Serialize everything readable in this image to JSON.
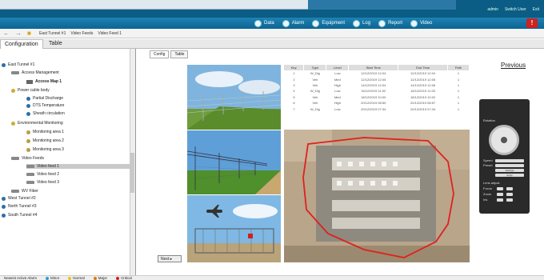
{
  "header": {
    "user": "admin",
    "switch_user": "Switch User",
    "exit": "Exit",
    "alarm_badge": "!"
  },
  "menu": [
    {
      "label": "Data",
      "icon": "data-icon"
    },
    {
      "label": "Alarm",
      "icon": "alarm-icon"
    },
    {
      "label": "Equipment",
      "icon": "equipment-icon"
    },
    {
      "label": "Log",
      "icon": "log-icon"
    },
    {
      "label": "Report",
      "icon": "report-icon"
    },
    {
      "label": "Video",
      "icon": "video-icon"
    }
  ],
  "breadcrumb": [
    "East Tunnel #1",
    "Video Feeds",
    "Video Feed 1"
  ],
  "main_tabs": [
    "Configuration",
    "Table"
  ],
  "sub_tabs": [
    "Config",
    "Table"
  ],
  "tree": [
    {
      "label": "East Tunnel #1",
      "level": 0
    },
    {
      "label": "Access Management",
      "level": 1
    },
    {
      "label": "Access Map 1",
      "level": 2,
      "bold": true
    },
    {
      "label": "Power cable body",
      "level": 1
    },
    {
      "label": "Partial Discharge",
      "level": 2
    },
    {
      "label": "DTS Temperature",
      "level": 2
    },
    {
      "label": "Sheath circulation",
      "level": 2
    },
    {
      "label": "Environmental Monitoring",
      "level": 1
    },
    {
      "label": "Monitoring area 1",
      "level": 2
    },
    {
      "label": "Monitoring area 2",
      "level": 2
    },
    {
      "label": "Monitoring area 3",
      "level": 2
    },
    {
      "label": "Video Feeds",
      "level": 1
    },
    {
      "label": "Video feed 1",
      "level": 2,
      "selected": true
    },
    {
      "label": "Video feed 2",
      "level": 2
    },
    {
      "label": "Video feed 3",
      "level": 2
    },
    {
      "label": "WV Fiber",
      "level": 1
    },
    {
      "label": "West Tunnel #2",
      "level": 0
    },
    {
      "label": "North Tunnel #3",
      "level": 0
    },
    {
      "label": "South Tunnel #4",
      "level": 0
    }
  ],
  "alarm_table": {
    "columns": [
      "Key",
      "Type",
      "Level",
      "Start Time",
      "End Time",
      "Path"
    ],
    "rows": [
      [
        "1",
        "W_Dig",
        "Low",
        "12/12/2019 12:04",
        "12/12/2019 12:04",
        "1"
      ],
      [
        "2",
        "Veh",
        "Med",
        "12/12/2019 12:05",
        "12/12/2019 12:05",
        "1"
      ],
      [
        "3",
        "Veh",
        "High",
        "14/12/2019 12:04",
        "14/12/2019 12:06",
        "1"
      ],
      [
        "4",
        "W_Dig",
        "Low",
        "16/12/2019 11:02",
        "16/12/2019 11:03",
        "1"
      ],
      [
        "5",
        "Veh",
        "Med",
        "18/12/2019 10:00",
        "18/12/2019 10:02",
        "1"
      ],
      [
        "6",
        "Veh",
        "High",
        "20/12/2019 08:50",
        "20/12/2019 08:57",
        "1"
      ],
      [
        "7",
        "W_Dig",
        "Low",
        "20/12/2019 07:34",
        "20/12/2019 07:34",
        "1"
      ]
    ]
  },
  "previous_label": "Previous",
  "next_label": "Next",
  "ptz": {
    "title": "Rotation",
    "speed_label": "Speed",
    "preset_label": "Preset",
    "settings_label": "Settings",
    "apply_label": "Apply",
    "lens_label": "Lens adjust",
    "focus_label": "Focus",
    "zoom_label": "Zoom",
    "iris_label": "Iris"
  },
  "status": {
    "newest_alarm": "Newest Active Alarm",
    "legend": [
      {
        "label": "Minor",
        "color": "#2a9fd6"
      },
      {
        "label": "Normal",
        "color": "#f0c020"
      },
      {
        "label": "Major",
        "color": "#e07a10"
      },
      {
        "label": "Critical",
        "color": "#d02020"
      }
    ]
  }
}
